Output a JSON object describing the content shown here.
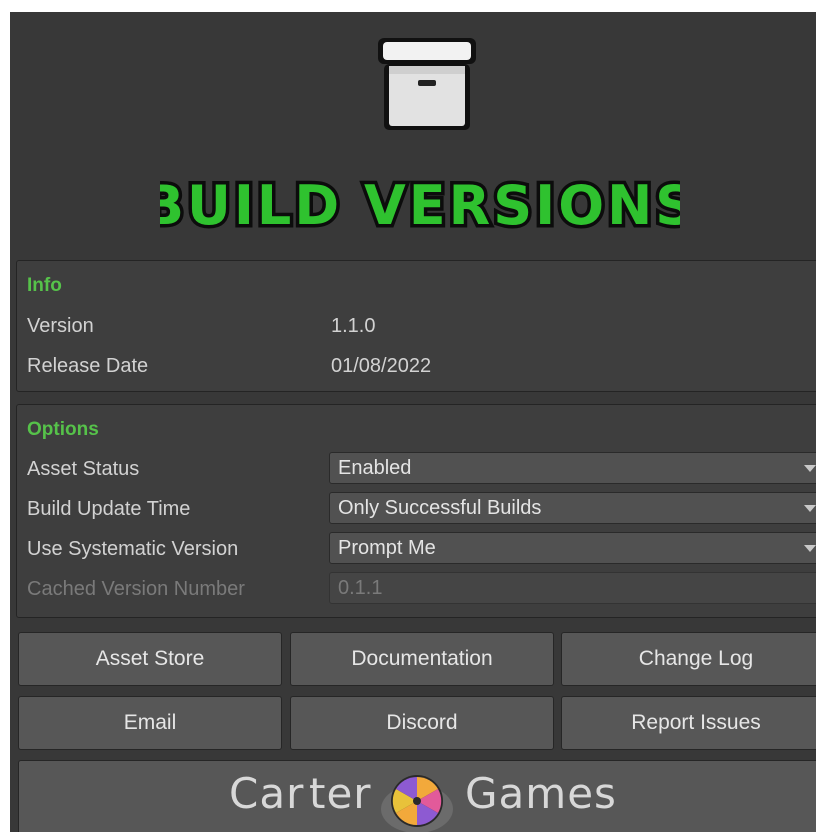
{
  "header": {
    "logo_icon": "storage-box-icon",
    "title": "BUILD VERSIONS",
    "title_color": "#2fc22f"
  },
  "info": {
    "title": "Info",
    "version_label": "Version",
    "version_value": "1.1.0",
    "release_date_label": "Release Date",
    "release_date_value": "01/08/2022"
  },
  "options": {
    "title": "Options",
    "asset_status_label": "Asset Status",
    "asset_status_value": "Enabled",
    "build_update_time_label": "Build Update Time",
    "build_update_time_value": "Only Successful Builds",
    "use_systematic_version_label": "Use Systematic Version",
    "use_systematic_version_value": "Prompt Me",
    "cached_version_number_label": "Cached Version Number",
    "cached_version_number_value": "0.1.1"
  },
  "buttons": {
    "asset_store": "Asset Store",
    "documentation": "Documentation",
    "change_log": "Change Log",
    "email": "Email",
    "discord": "Discord",
    "report_issues": "Report Issues"
  },
  "footer": {
    "brand_left": "Car",
    "brand_mid": "ter",
    "brand_right": "Games",
    "logo_icon": "carter-games-logo-icon"
  },
  "colors": {
    "accent_green": "#56c24a",
    "panel_bg": "#3e3e3e",
    "window_bg": "#383838"
  }
}
